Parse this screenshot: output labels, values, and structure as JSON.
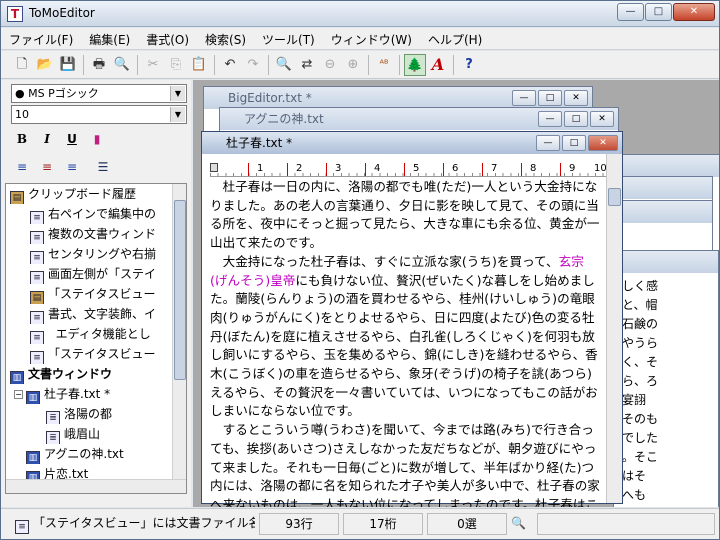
{
  "app": {
    "title": "ToMoEditor",
    "icon": "T"
  },
  "window_buttons": {
    "minimize": "—",
    "maximize": "□",
    "close": "✕"
  },
  "menu": [
    {
      "label": "ファイル(F)"
    },
    {
      "label": "編集(E)"
    },
    {
      "label": "書式(O)"
    },
    {
      "label": "検索(S)"
    },
    {
      "label": "ツール(T)"
    },
    {
      "label": "ウィンドウ(W)"
    },
    {
      "label": "ヘルプ(H)"
    }
  ],
  "toolbar": {
    "new": "🗋",
    "open": "📂",
    "save": "💾",
    "print": "🖶",
    "preview": "🔍",
    "cut": "✂",
    "copy": "⎘",
    "paste": "📋",
    "undo": "↶",
    "redo": "↷",
    "find": "🔍",
    "replace": "⇄",
    "find_prev": "⊖",
    "find_next": "⊕",
    "spell": "ᴬᴮ",
    "tree": "🌲",
    "font": "A",
    "help": "?"
  },
  "format": {
    "font_name": "● MS Pゴシック",
    "font_size": "10",
    "bold": "B",
    "italic": "I",
    "underline": "U",
    "color": "▮",
    "align_left": "≡",
    "align_center": "≡",
    "align_right": "≡",
    "list": "☰"
  },
  "tree": {
    "items": [
      {
        "label": "クリップボード履歴",
        "icon": "clip",
        "indent": 0,
        "bold": false
      },
      {
        "label": "右ペインで編集中の",
        "icon": "doc",
        "indent": 1,
        "bold": false
      },
      {
        "label": "複数の文書ウィンド",
        "icon": "doc",
        "indent": 1,
        "bold": false
      },
      {
        "label": "センタリングや右揃",
        "icon": "doc",
        "indent": 1,
        "bold": false
      },
      {
        "label": "画面左側が「ステイ",
        "icon": "doc",
        "indent": 1,
        "bold": false
      },
      {
        "label": "「ステイタスビュー",
        "icon": "clip",
        "indent": 1,
        "bold": false
      },
      {
        "label": "書式、文字装飾、イ",
        "icon": "doc",
        "indent": 1,
        "bold": false
      },
      {
        "label": "エディタ機能とし",
        "icon": "doc",
        "indent": 1,
        "bold": false
      },
      {
        "label": "「ステイタスビュー",
        "icon": "doc",
        "indent": 1,
        "bold": false
      },
      {
        "label": "文書ウィンドウ",
        "icon": "book",
        "indent": 0,
        "bold": true
      },
      {
        "label": "杜子春.txt *",
        "icon": "book",
        "indent": 1,
        "bold": false
      },
      {
        "label": "洛陽の都",
        "icon": "list",
        "indent": 2,
        "bold": false
      },
      {
        "label": "峨眉山",
        "icon": "list",
        "indent": 2,
        "bold": false
      },
      {
        "label": "アグニの神.txt",
        "icon": "book",
        "indent": 1,
        "bold": false
      },
      {
        "label": "片恋.txt",
        "icon": "book",
        "indent": 1,
        "bold": false
      }
    ]
  },
  "windows": {
    "big": {
      "title": "BigEditor.txt *"
    },
    "agni": {
      "title": "アグニの神.txt"
    },
    "toshi": {
      "title": "杜子春.txt *"
    }
  },
  "ruler": {
    "labels": [
      "1",
      "2",
      "3",
      "4",
      "5",
      "6",
      "7",
      "8",
      "9",
      "10"
    ]
  },
  "editor": {
    "p1": "杜子春は一日の内に、洛陽の都でも唯(ただ)一人という大金持になりました。あの老人の言葉通り、夕日に影を映して見て、その頭に当る所を、夜中にそっと掘って見たら、大きな車にも余る位、黄金が一山出て来たのです。",
    "p2a": "大金持になった杜子春は、すぐに立派な家(うち)を買って、",
    "p2_highlight": "玄宗(げんそう)皇帝",
    "p2b": "にも負けない位、贅沢(ぜいたく)な暮しをし始めました。蘭陵(らんりょう)の酒を買わせるやら、桂州(けいしゅう)の竜眼肉(りゅうがんにく)をとりよせるやら、日に四度(よたび)色の変る牡丹(ぼたん)を庭に植えさせるやら、白孔雀(しろくじゃく)を何羽も放し飼いにするやら、玉を集めるやら、錦(にしき)を縫わせるやら、香木(こうぼく)の車を造らせるやら、象牙(ぞうげ)の椅子を誂(あつら)えるやら、その贅沢を一々書いていては、いつになってもこの話がおしまいにならない位です。",
    "p3": "するとこういう噂(うわさ)を聞いて、今までは路(みち)で行き合っても、挨拶(あいさつ)さえしなかった友だちなどが、朝夕遊びにやって来ました。それも一日毎(ごと)に数が増して、半年ばかり経(た)つ内には、洛陽の都に名を知られた才子や美人が多い中で、杜子春の家へ来ないものは、一人もない位になってしまったのです。杜子春はこの御馳走を相手に、毎日酒盛りを開きました。その酒盛りの又盛(さか"
  },
  "bg_fragments": [
    "しく感",
    "と、帽",
    "石鹸の",
    "やうら",
    "く、そ",
    "ら、ろ",
    "宴詡",
    "そのも",
    "でした",
    "。そこ",
    "はそ",
    "へも",
    "も、思"
  ],
  "status": {
    "message": "「ステイタスビュー」には文書ファイル名",
    "line": "93行",
    "column": "17桁",
    "selection": "0選",
    "search_icon": "🔍"
  }
}
